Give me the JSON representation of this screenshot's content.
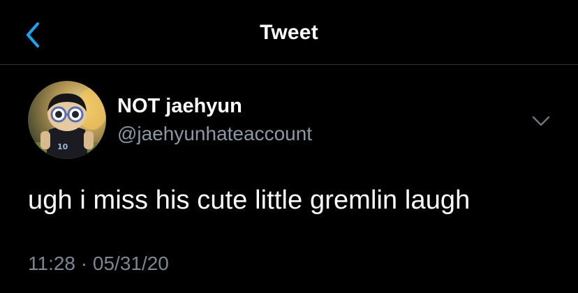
{
  "header": {
    "title": "Tweet",
    "back_icon": "chevron-left-icon"
  },
  "tweet": {
    "display_name": "NOT jaehyun",
    "handle": "@jaehyunhateaccount",
    "text": "ugh i miss his cute little gremlin laugh",
    "time": "11:28",
    "separator": "·",
    "date": "05/31/20",
    "more_icon": "chevron-down-icon",
    "avatar_jersey_number": "10"
  },
  "colors": {
    "background": "#000000",
    "accent": "#1da1f2",
    "primary_text": "#ffffff",
    "secondary_text": "#8b98a5",
    "divider": "#2f3336"
  }
}
